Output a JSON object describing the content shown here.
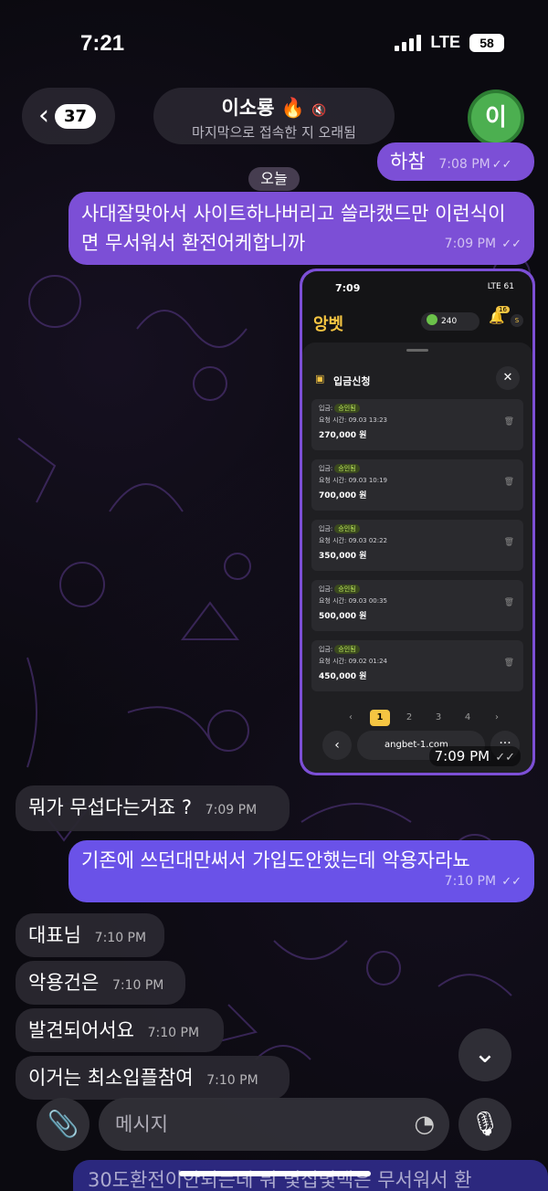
{
  "status": {
    "time": "7:21",
    "network": "LTE",
    "battery": "58"
  },
  "header": {
    "unread_count": "37",
    "title": "이소룡 🔥",
    "subtitle": "마지막으로 접속한 지 오래됨",
    "avatar_letter": "이"
  },
  "messages": [
    {
      "text": "하참",
      "time": "7:08 PM"
    },
    {
      "date_chip": "오늘"
    },
    {
      "text": "사대잘맞아서 사이트하나버리고 쓸라캤드만 이런식이면 무서워서 환전어케합니까",
      "time": "7:09 PM"
    },
    {
      "time": "7:09 PM"
    },
    {
      "text": "뭐가 무섭다는거죠 ?",
      "time": "7:09 PM"
    },
    {
      "text": "기존에 쓰던대만써서 가입도안했는데 악용자라뇨",
      "time": "7:10 PM"
    },
    {
      "text": "대표님",
      "time": "7:10 PM"
    },
    {
      "text": "악용건은",
      "time": "7:10 PM"
    },
    {
      "text": "발견되어서요",
      "time": "7:10 PM"
    },
    {
      "text": "이거는 최소입플참여",
      "time": "7:10 PM"
    }
  ],
  "screenshot": {
    "status_time": "7:09",
    "status_right": "LTE 61",
    "logo": "앙벳",
    "coins": "240",
    "bell_badge": "16",
    "s_badge": "S",
    "sheet_title": "입금신청",
    "deposits": [
      {
        "label": "입금:",
        "status": "승인됨",
        "request": "요청 시간: 09.03 13:23",
        "amount": "270,000 원"
      },
      {
        "label": "입금:",
        "status": "승인됨",
        "request": "요청 시간: 09.03 10:19",
        "amount": "700,000 원"
      },
      {
        "label": "입금:",
        "status": "승인됨",
        "request": "요청 시간: 09.03 02:22",
        "amount": "350,000 원"
      },
      {
        "label": "입금:",
        "status": "승인됨",
        "request": "요청 시간: 09.03 00:35",
        "amount": "500,000 원"
      },
      {
        "label": "입금:",
        "status": "승인됨",
        "request": "요청 시간: 09.02 01:24",
        "amount": "450,000 원"
      }
    ],
    "pages": [
      "‹",
      "1",
      "2",
      "3",
      "4",
      "›"
    ],
    "url": "angbet-1.com"
  },
  "input": {
    "placeholder": "메시지"
  },
  "bottom_peek_text": "30도환전이안되는데 뭐 몇십몇백은 무서워서 환",
  "icons": {
    "back": "chevron-left-icon",
    "mute": "mute-icon",
    "attach": "paperclip-icon",
    "sticker": "sticker-icon",
    "mic": "microphone-icon",
    "scroll": "chevron-down-icon"
  },
  "colors": {
    "outgoing": "#7c4fd6",
    "outgoing_alt": "#6a52e8",
    "incoming": "#2a2830",
    "avatar": "#4caf50"
  }
}
